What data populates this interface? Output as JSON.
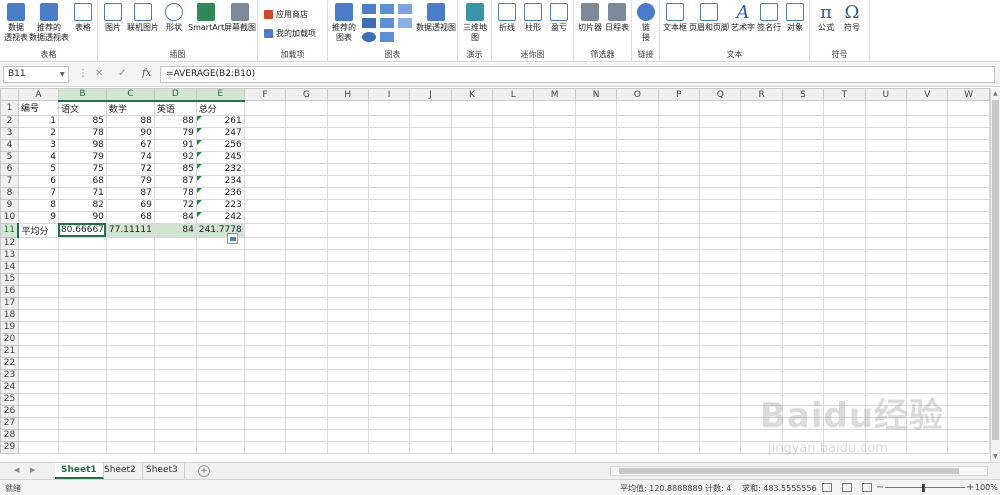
{
  "ribbon": {
    "groups": {
      "tables": "表格",
      "illustrations": "插图",
      "addins": "加载项",
      "charts": "图表",
      "tours": "演示",
      "sparklines": "迷你图",
      "filters": "筛选器",
      "links": "链接",
      "text": "文本",
      "symbols": "符号"
    },
    "buttons": {
      "pivot_table_1": "数据",
      "pivot_table_2": "透视表",
      "rec_pivot_1": "推荐的",
      "rec_pivot_2": "数据透视表",
      "table": "表格",
      "pictures": "图片",
      "online_pictures": "联机图片",
      "shapes": "形状",
      "smartart": "SmartArt",
      "screenshot": "屏幕截图",
      "store": "应用商店",
      "my_addins": "我的加载项",
      "rec_charts_1": "推荐的",
      "rec_charts_2": "图表",
      "pivot_chart": "数据透视图",
      "map_3d_1": "三维地",
      "map_3d_2": "图",
      "line": "折线",
      "column": "柱形",
      "win_loss": "盈亏",
      "slicer": "切片器",
      "timeline": "日程表",
      "link_1": "链",
      "link_2": "接",
      "textbox": "文本框",
      "header_footer": "页眉和页脚",
      "wordart": "艺术字",
      "signature": "签名行",
      "object": "对象",
      "equation": "公式",
      "symbol": "符号"
    }
  },
  "formula_bar": {
    "name_box": "B11",
    "formula": "=AVERAGE(B2:B10)",
    "fx": "fx"
  },
  "columns": [
    "A",
    "B",
    "C",
    "D",
    "E",
    "F",
    "G",
    "H",
    "I",
    "J",
    "K",
    "L",
    "M",
    "N",
    "O",
    "P",
    "Q",
    "R",
    "S",
    "T",
    "U",
    "V",
    "W"
  ],
  "rows": [
    [
      "编号",
      "语文",
      "数学",
      "英语",
      "总分"
    ],
    [
      "1",
      "85",
      "88",
      "88",
      "261"
    ],
    [
      "2",
      "78",
      "90",
      "79",
      "247"
    ],
    [
      "3",
      "98",
      "67",
      "91",
      "256"
    ],
    [
      "4",
      "79",
      "74",
      "92",
      "245"
    ],
    [
      "5",
      "75",
      "72",
      "85",
      "232"
    ],
    [
      "6",
      "68",
      "79",
      "87",
      "234"
    ],
    [
      "7",
      "71",
      "87",
      "78",
      "236"
    ],
    [
      "8",
      "82",
      "69",
      "72",
      "223"
    ],
    [
      "9",
      "90",
      "68",
      "84",
      "242"
    ],
    [
      "平均分",
      "80.66667",
      "77.11111",
      "84",
      "241.7778"
    ]
  ],
  "total_rows": 29,
  "sheets": [
    "Sheet1",
    "Sheet2",
    "Sheet3"
  ],
  "active_sheet": "Sheet1",
  "status": {
    "ready": "就绪",
    "average": "平均值: 120.8888889",
    "count": "计数: 4",
    "sum": "求和: 483.5555556",
    "zoom": "100%"
  },
  "watermark": {
    "brand": "Baidu经验",
    "url": "jingyan.baidu.com"
  },
  "colors": {
    "excel_green": "#217346",
    "selection_fill": "#d3e3d3",
    "error_triangle": "#1f8b3a"
  }
}
